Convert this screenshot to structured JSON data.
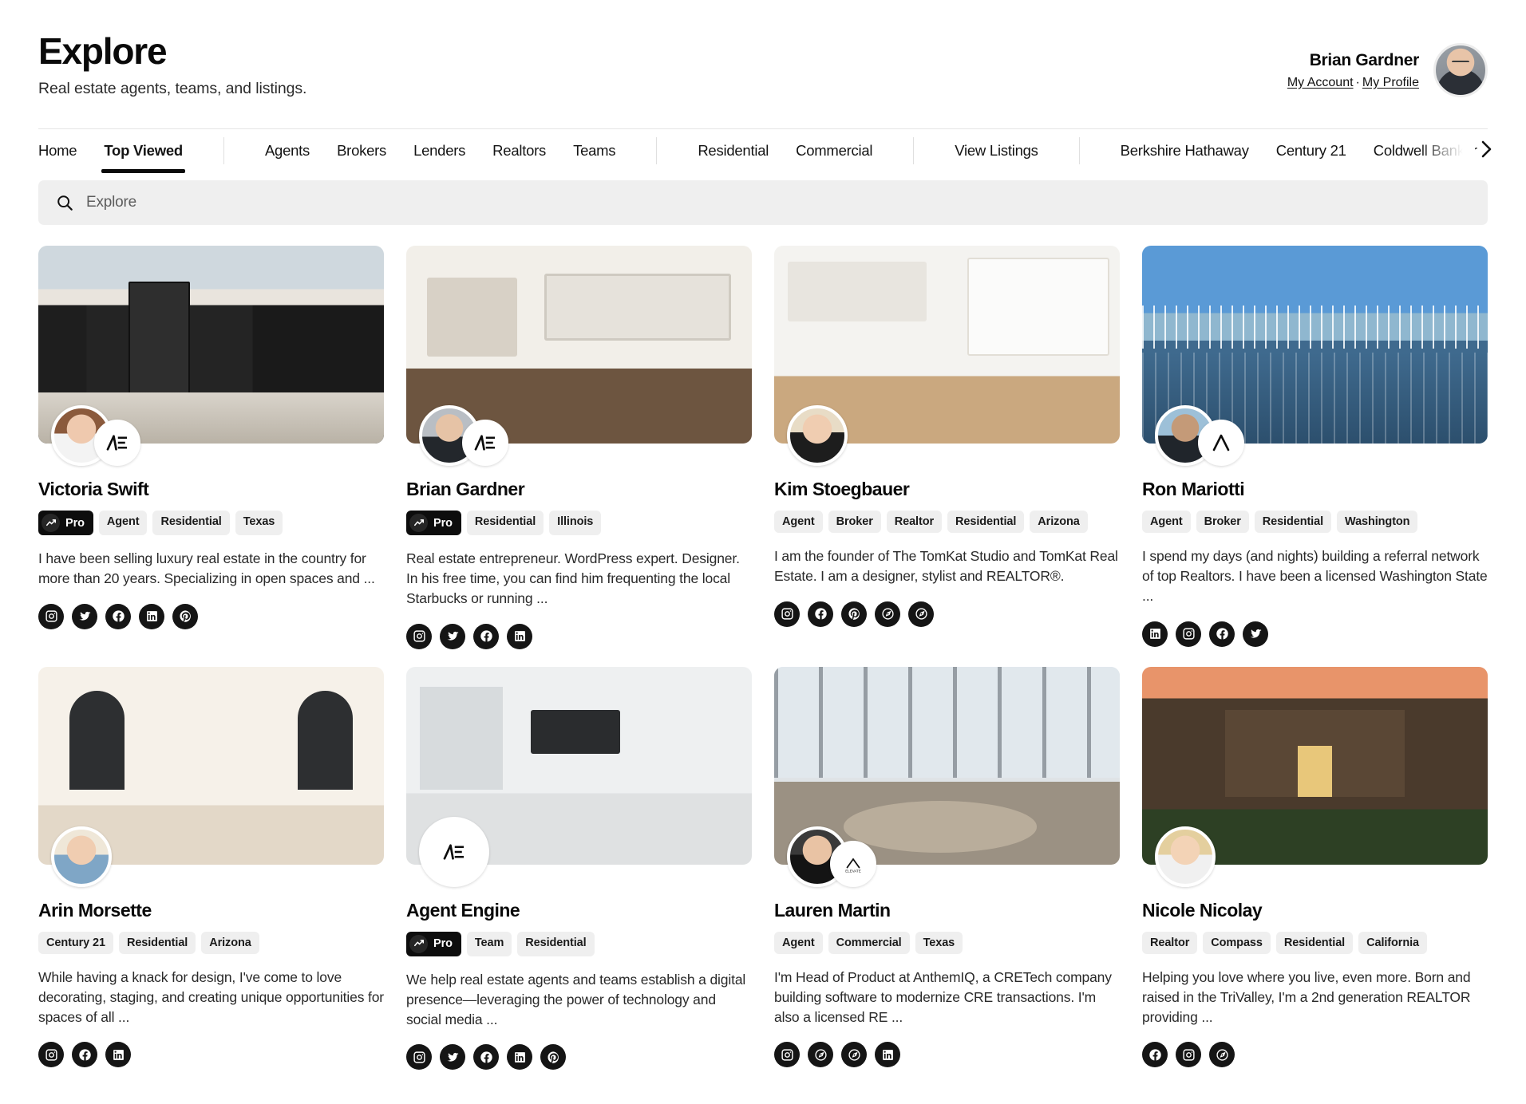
{
  "header": {
    "title": "Explore",
    "subtitle": "Real estate agents, teams, and listings.",
    "user_name": "Brian Gardner",
    "account_link": "My Account",
    "link_separator": "·",
    "profile_link": "My Profile",
    "avatar_name": "user-avatar"
  },
  "nav": {
    "primary": [
      {
        "label": "Home",
        "active": false
      },
      {
        "label": "Top Viewed",
        "active": true
      }
    ],
    "roles": [
      {
        "label": "Agents"
      },
      {
        "label": "Brokers"
      },
      {
        "label": "Lenders"
      },
      {
        "label": "Realtors"
      },
      {
        "label": "Teams"
      }
    ],
    "categories": [
      {
        "label": "Residential"
      },
      {
        "label": "Commercial"
      }
    ],
    "listings": [
      {
        "label": "View Listings"
      }
    ],
    "brands": [
      {
        "label": "Berkshire Hathaway"
      },
      {
        "label": "Century 21"
      },
      {
        "label": "Coldwell Banker"
      }
    ],
    "overflow_icon": "chevron-right-icon"
  },
  "search": {
    "placeholder": "Explore",
    "value": "",
    "icon": "search-icon"
  },
  "cards": [
    {
      "name": "Victoria Swift",
      "photo": "ph-dark-house",
      "avatar": "av-f1",
      "badge_logo": "agent-engine-logo",
      "badge_solo": false,
      "tags": [
        {
          "label": "Pro",
          "pro": true,
          "icon": "trending-up-icon"
        },
        {
          "label": "Agent",
          "pro": false
        },
        {
          "label": "Residential",
          "pro": false
        },
        {
          "label": "Texas",
          "pro": false
        }
      ],
      "bio": "I have been selling luxury real estate in the country for more than 20 years. Specializing in open spaces and ...",
      "socials": [
        "instagram",
        "twitter",
        "facebook",
        "linkedin",
        "pinterest"
      ]
    },
    {
      "name": "Brian Gardner",
      "photo": "ph-living1",
      "avatar": "av-m1",
      "badge_logo": "agent-engine-logo",
      "badge_solo": false,
      "tags": [
        {
          "label": "Pro",
          "pro": true,
          "icon": "trending-up-icon"
        },
        {
          "label": "Residential",
          "pro": false
        },
        {
          "label": "Illinois",
          "pro": false
        }
      ],
      "bio": "Real estate entrepreneur. WordPress expert. Designer. In his free time, you can find him frequenting the local Starbucks or running ...",
      "socials": [
        "instagram",
        "twitter",
        "facebook",
        "linkedin"
      ]
    },
    {
      "name": "Kim Stoegbauer",
      "photo": "ph-kitchen",
      "avatar": "av-f2",
      "badge_logo": "",
      "badge_solo": false,
      "tags": [
        {
          "label": "Agent",
          "pro": false
        },
        {
          "label": "Broker",
          "pro": false
        },
        {
          "label": "Realtor",
          "pro": false
        },
        {
          "label": "Residential",
          "pro": false
        },
        {
          "label": "Arizona",
          "pro": false
        }
      ],
      "bio": "I am the founder of The TomKat Studio and TomKat Real Estate. I am a designer, stylist and REALTOR®.",
      "socials": [
        "instagram",
        "facebook",
        "pinterest",
        "link",
        "link"
      ]
    },
    {
      "name": "Ron Mariotti",
      "photo": "ph-marina",
      "avatar": "av-m2",
      "badge_logo": "compass-a-logo",
      "badge_solo": false,
      "tags": [
        {
          "label": "Agent",
          "pro": false
        },
        {
          "label": "Broker",
          "pro": false
        },
        {
          "label": "Residential",
          "pro": false
        },
        {
          "label": "Washington",
          "pro": false
        }
      ],
      "bio": "I spend my days (and nights) building a referral network of top Realtors. I have been a licensed Washington State ...",
      "socials": [
        "linkedin",
        "instagram",
        "facebook",
        "twitter"
      ]
    },
    {
      "name": "Arin Morsette",
      "photo": "ph-arches",
      "avatar": "av-f3",
      "badge_logo": "",
      "badge_solo": false,
      "tags": [
        {
          "label": "Century 21",
          "pro": false
        },
        {
          "label": "Residential",
          "pro": false
        },
        {
          "label": "Arizona",
          "pro": false
        }
      ],
      "bio": "While having a knack for design, I've come to love decorating, staging, and creating unique opportunities for spaces of all ...",
      "socials": [
        "instagram",
        "facebook",
        "linkedin"
      ]
    },
    {
      "name": "Agent Engine",
      "photo": "ph-modern",
      "avatar": "",
      "badge_logo": "agent-engine-logo",
      "badge_solo": true,
      "tags": [
        {
          "label": "Pro",
          "pro": true,
          "icon": "trending-up-icon"
        },
        {
          "label": "Team",
          "pro": false
        },
        {
          "label": "Residential",
          "pro": false
        }
      ],
      "bio": "We help real estate agents and teams establish a digital presence—leveraging the power of technology and social media ...",
      "socials": [
        "instagram",
        "twitter",
        "facebook",
        "linkedin",
        "pinterest"
      ]
    },
    {
      "name": "Lauren Martin",
      "photo": "ph-office",
      "avatar": "av-f4",
      "badge_logo": "elevate-logo",
      "badge_solo": false,
      "tags": [
        {
          "label": "Agent",
          "pro": false
        },
        {
          "label": "Commercial",
          "pro": false
        },
        {
          "label": "Texas",
          "pro": false
        }
      ],
      "bio": "I'm Head of Product at AnthemIQ, a CRETech company building software to modernize CRE transactions. I'm also a licensed RE ...",
      "socials": [
        "instagram",
        "link",
        "link",
        "linkedin"
      ]
    },
    {
      "name": "Nicole Nicolay",
      "photo": "ph-craftsman",
      "avatar": "av-f5",
      "badge_logo": "",
      "badge_solo": false,
      "tags": [
        {
          "label": "Realtor",
          "pro": false
        },
        {
          "label": "Compass",
          "pro": false
        },
        {
          "label": "Residential",
          "pro": false
        },
        {
          "label": "California",
          "pro": false
        }
      ],
      "bio": "Helping you love where you live, even more. Born and raised in the TriValley, I'm a 2nd generation REALTOR providing ...",
      "socials": [
        "facebook",
        "instagram",
        "link"
      ]
    }
  ],
  "colors": {
    "accent": "#0d0d0d",
    "tag_bg": "#efefef",
    "search_bg": "#efefef",
    "text": "#111111"
  }
}
